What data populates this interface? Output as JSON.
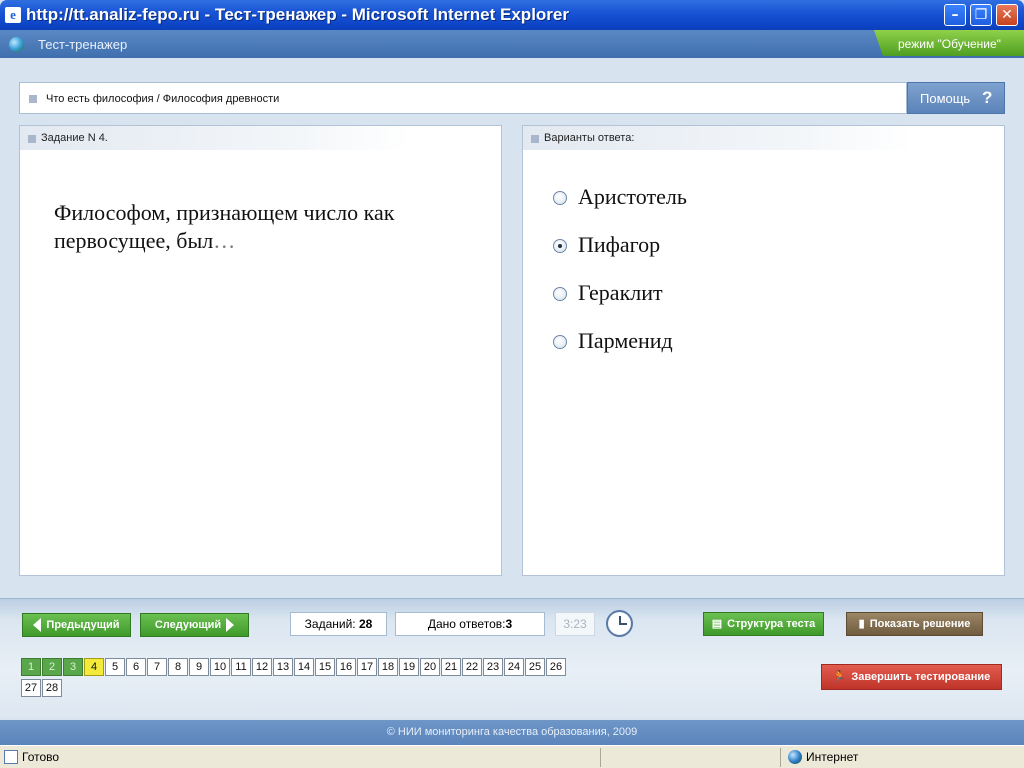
{
  "window": {
    "title": "http://tt.analiz-fepo.ru - Тест-тренажер - Microsoft Internet Explorer",
    "app_icon": "e",
    "minimize": "–",
    "maximize": "❐",
    "close": "✕"
  },
  "app": {
    "title": "Тест-тренажер",
    "mode": "режим \"Обучение\""
  },
  "breadcrumb": "Что есть философия / Философия древности",
  "help": {
    "label": "Помощь",
    "icon": "?"
  },
  "task_panel": {
    "header": "Задание N 4.",
    "question": "Философом, признающем число как первосущее, был",
    "ellipsis": "…"
  },
  "answers_panel": {
    "header": "Варианты ответа:",
    "options": [
      {
        "label": "Аристотель",
        "selected": false
      },
      {
        "label": "Пифагор",
        "selected": true
      },
      {
        "label": "Гераклит",
        "selected": false
      },
      {
        "label": "Парменид",
        "selected": false
      }
    ]
  },
  "controls": {
    "prev": "Предыдущий",
    "next": "Следующий",
    "tasks_label": "Заданий:",
    "tasks_count": "28",
    "answers_label": "Дано ответов:",
    "answers_count": "3",
    "timer": "3:23",
    "structure": "Структура теста",
    "show_solution": "Показать решение",
    "finish": "Завершить тестирование"
  },
  "task_numbers": {
    "done": [
      "1",
      "2",
      "3"
    ],
    "current": "4",
    "rest": [
      "5",
      "6",
      "7",
      "8",
      "9",
      "10",
      "11",
      "12",
      "13",
      "14",
      "15",
      "16",
      "17",
      "18",
      "19",
      "20",
      "21",
      "22",
      "23",
      "24",
      "25",
      "26",
      "27",
      "28"
    ]
  },
  "footer": "© НИИ мониторинга качества образования, 2009",
  "statusbar": {
    "status": "Готово",
    "zone": "Интернет"
  },
  "colors": {
    "accent": "#5a84bc",
    "done": "#5aa64a",
    "current": "#f3ea3a",
    "finish": "#c0342a"
  }
}
